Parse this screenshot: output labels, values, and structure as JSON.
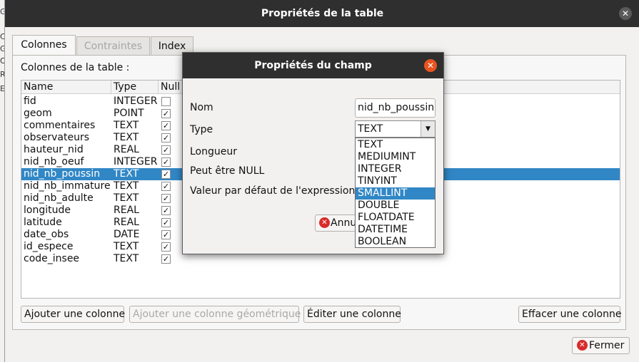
{
  "background_app": {
    "visible_chars": [
      "G",
      "C",
      "G",
      "O",
      "R",
      "E"
    ]
  },
  "window": {
    "title": "Propriétés de la table",
    "close_glyph": "✕"
  },
  "tabs": [
    {
      "label": "Colonnes",
      "state": "active"
    },
    {
      "label": "Contraintes",
      "state": "disabled"
    },
    {
      "label": "Index",
      "state": "normal"
    }
  ],
  "columns_section": {
    "label": "Colonnes de la table :"
  },
  "table": {
    "headers": [
      "Name",
      "Type",
      "Null"
    ],
    "rows": [
      {
        "name": "fid",
        "type": "INTEGER",
        "null": false,
        "selected": false
      },
      {
        "name": "geom",
        "type": "POINT",
        "null": true,
        "selected": false
      },
      {
        "name": "commentaires",
        "type": "TEXT",
        "null": true,
        "selected": false
      },
      {
        "name": "observateurs",
        "type": "TEXT",
        "null": true,
        "selected": false
      },
      {
        "name": "hauteur_nid",
        "type": "REAL",
        "null": true,
        "selected": false
      },
      {
        "name": "nid_nb_oeuf",
        "type": "INTEGER",
        "null": true,
        "selected": false
      },
      {
        "name": "nid_nb_poussin",
        "type": "TEXT",
        "null": true,
        "selected": true
      },
      {
        "name": "nid_nb_immature",
        "type": "TEXT",
        "null": true,
        "selected": false
      },
      {
        "name": "nid_nb_adulte",
        "type": "TEXT",
        "null": true,
        "selected": false
      },
      {
        "name": "longitude",
        "type": "REAL",
        "null": true,
        "selected": false
      },
      {
        "name": "latitude",
        "type": "REAL",
        "null": true,
        "selected": false
      },
      {
        "name": "date_obs",
        "type": "DATE",
        "null": true,
        "selected": false
      },
      {
        "name": "id_espece",
        "type": "TEXT",
        "null": true,
        "selected": false
      },
      {
        "name": "code_insee",
        "type": "TEXT",
        "null": true,
        "selected": false
      }
    ]
  },
  "buttons": {
    "add_column": "Ajouter une colonne",
    "add_geometry_column": "Ajouter une colonne géométrique",
    "edit_column": "Éditer une colonne",
    "delete_column": "Effacer une colonne",
    "close": "Fermer"
  },
  "field_dialog": {
    "title": "Propriétés du champ",
    "labels": {
      "name": "Nom",
      "type": "Type",
      "length": "Longueur",
      "nullable": "Peut être NULL",
      "default": "Valeur par défaut de l'expression"
    },
    "name_value": "nid_nb_poussin",
    "type_value": "TEXT",
    "type_options": [
      "TEXT",
      "MEDIUMINT",
      "INTEGER",
      "TINYINT",
      "SMALLINT",
      "DOUBLE",
      "FLOATDATE",
      "DATETIME",
      "BOOLEAN"
    ],
    "highlighted_option": "SMALLINT",
    "cancel_label": "Annu"
  },
  "icons": {
    "window_close": "close-icon",
    "dialog_close": "close-icon",
    "cancel": "cancel-icon",
    "fermer": "cancel-icon",
    "combo_arrow": "chevron-down-icon",
    "checkbox": "check-icon"
  },
  "colors": {
    "titlebar": "#2f2f2f",
    "selection": "#3187c6",
    "close_orange": "#e95420",
    "cancel_red": "#d92b2b"
  }
}
